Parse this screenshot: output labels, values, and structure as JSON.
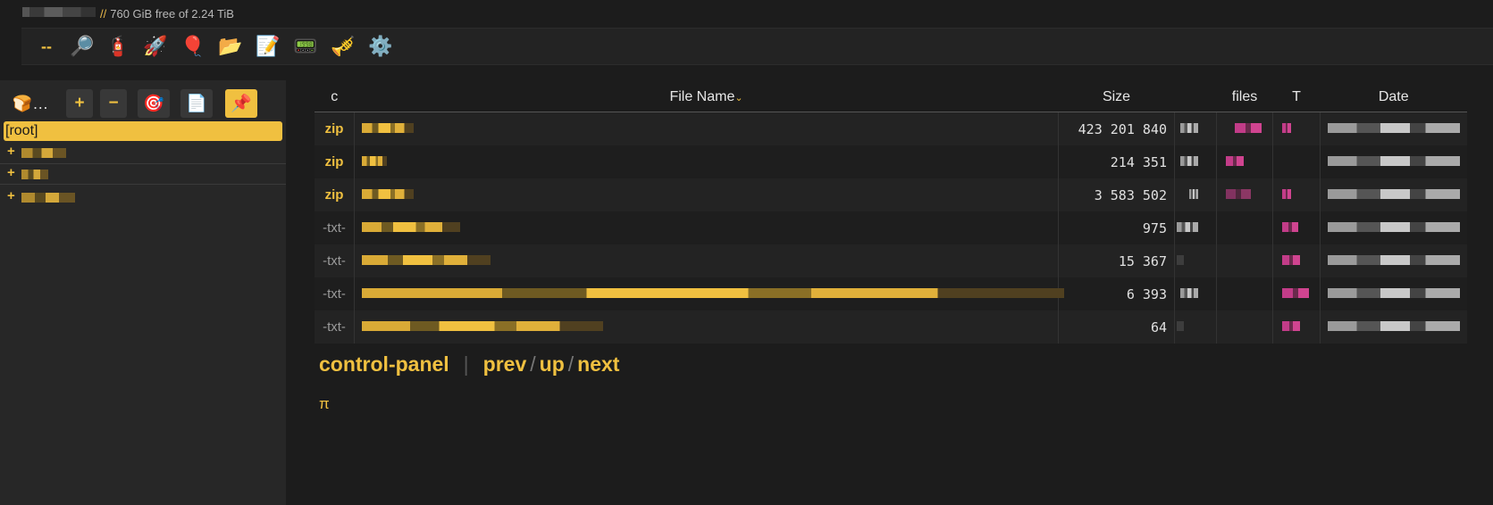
{
  "header": {
    "path_separator": "//",
    "disk_free": "760 GiB free of 2.24 TiB"
  },
  "toolbar": {
    "items": [
      {
        "name": "dashes",
        "glyph": "--"
      },
      {
        "name": "search",
        "glyph": "🔎"
      },
      {
        "name": "fire-extinguisher",
        "glyph": "🧯"
      },
      {
        "name": "rocket",
        "glyph": "🚀"
      },
      {
        "name": "balloon",
        "glyph": "🎈"
      },
      {
        "name": "folder",
        "glyph": "📂"
      },
      {
        "name": "notepad",
        "glyph": "📝"
      },
      {
        "name": "terminal",
        "glyph": "📟"
      },
      {
        "name": "trumpet",
        "glyph": "🎺"
      },
      {
        "name": "gear",
        "glyph": "⚙️"
      }
    ]
  },
  "sidebar": {
    "bread_label": "🍞…",
    "plus": "+",
    "minus": "−",
    "target": "🎯",
    "scroll": "📄",
    "pin": "📌",
    "root": "[root]",
    "tree": [
      "+",
      "+",
      "+"
    ]
  },
  "table": {
    "headers": {
      "c": "c",
      "name": "File Name",
      "sort_arrow": "⌄",
      "size": "Size",
      "files": "files",
      "t": "T",
      "date": "Date"
    },
    "rows": [
      {
        "type": "zip",
        "size": "423 201 840"
      },
      {
        "type": "zip",
        "size": "214 351"
      },
      {
        "type": "zip",
        "size": "3 583 502"
      },
      {
        "type": "-txt-",
        "size": "975"
      },
      {
        "type": "-txt-",
        "size": "15 367"
      },
      {
        "type": "-txt-",
        "size": "6 393"
      },
      {
        "type": "-txt-",
        "size": "64"
      }
    ]
  },
  "footer": {
    "control_panel": "control-panel",
    "prev": "prev",
    "up": "up",
    "next": "next",
    "slash": "/",
    "pi": "π"
  },
  "colors": {
    "accent": "#f0c040",
    "background": "#1c1c1c",
    "tag_pink": "#c23c88"
  }
}
